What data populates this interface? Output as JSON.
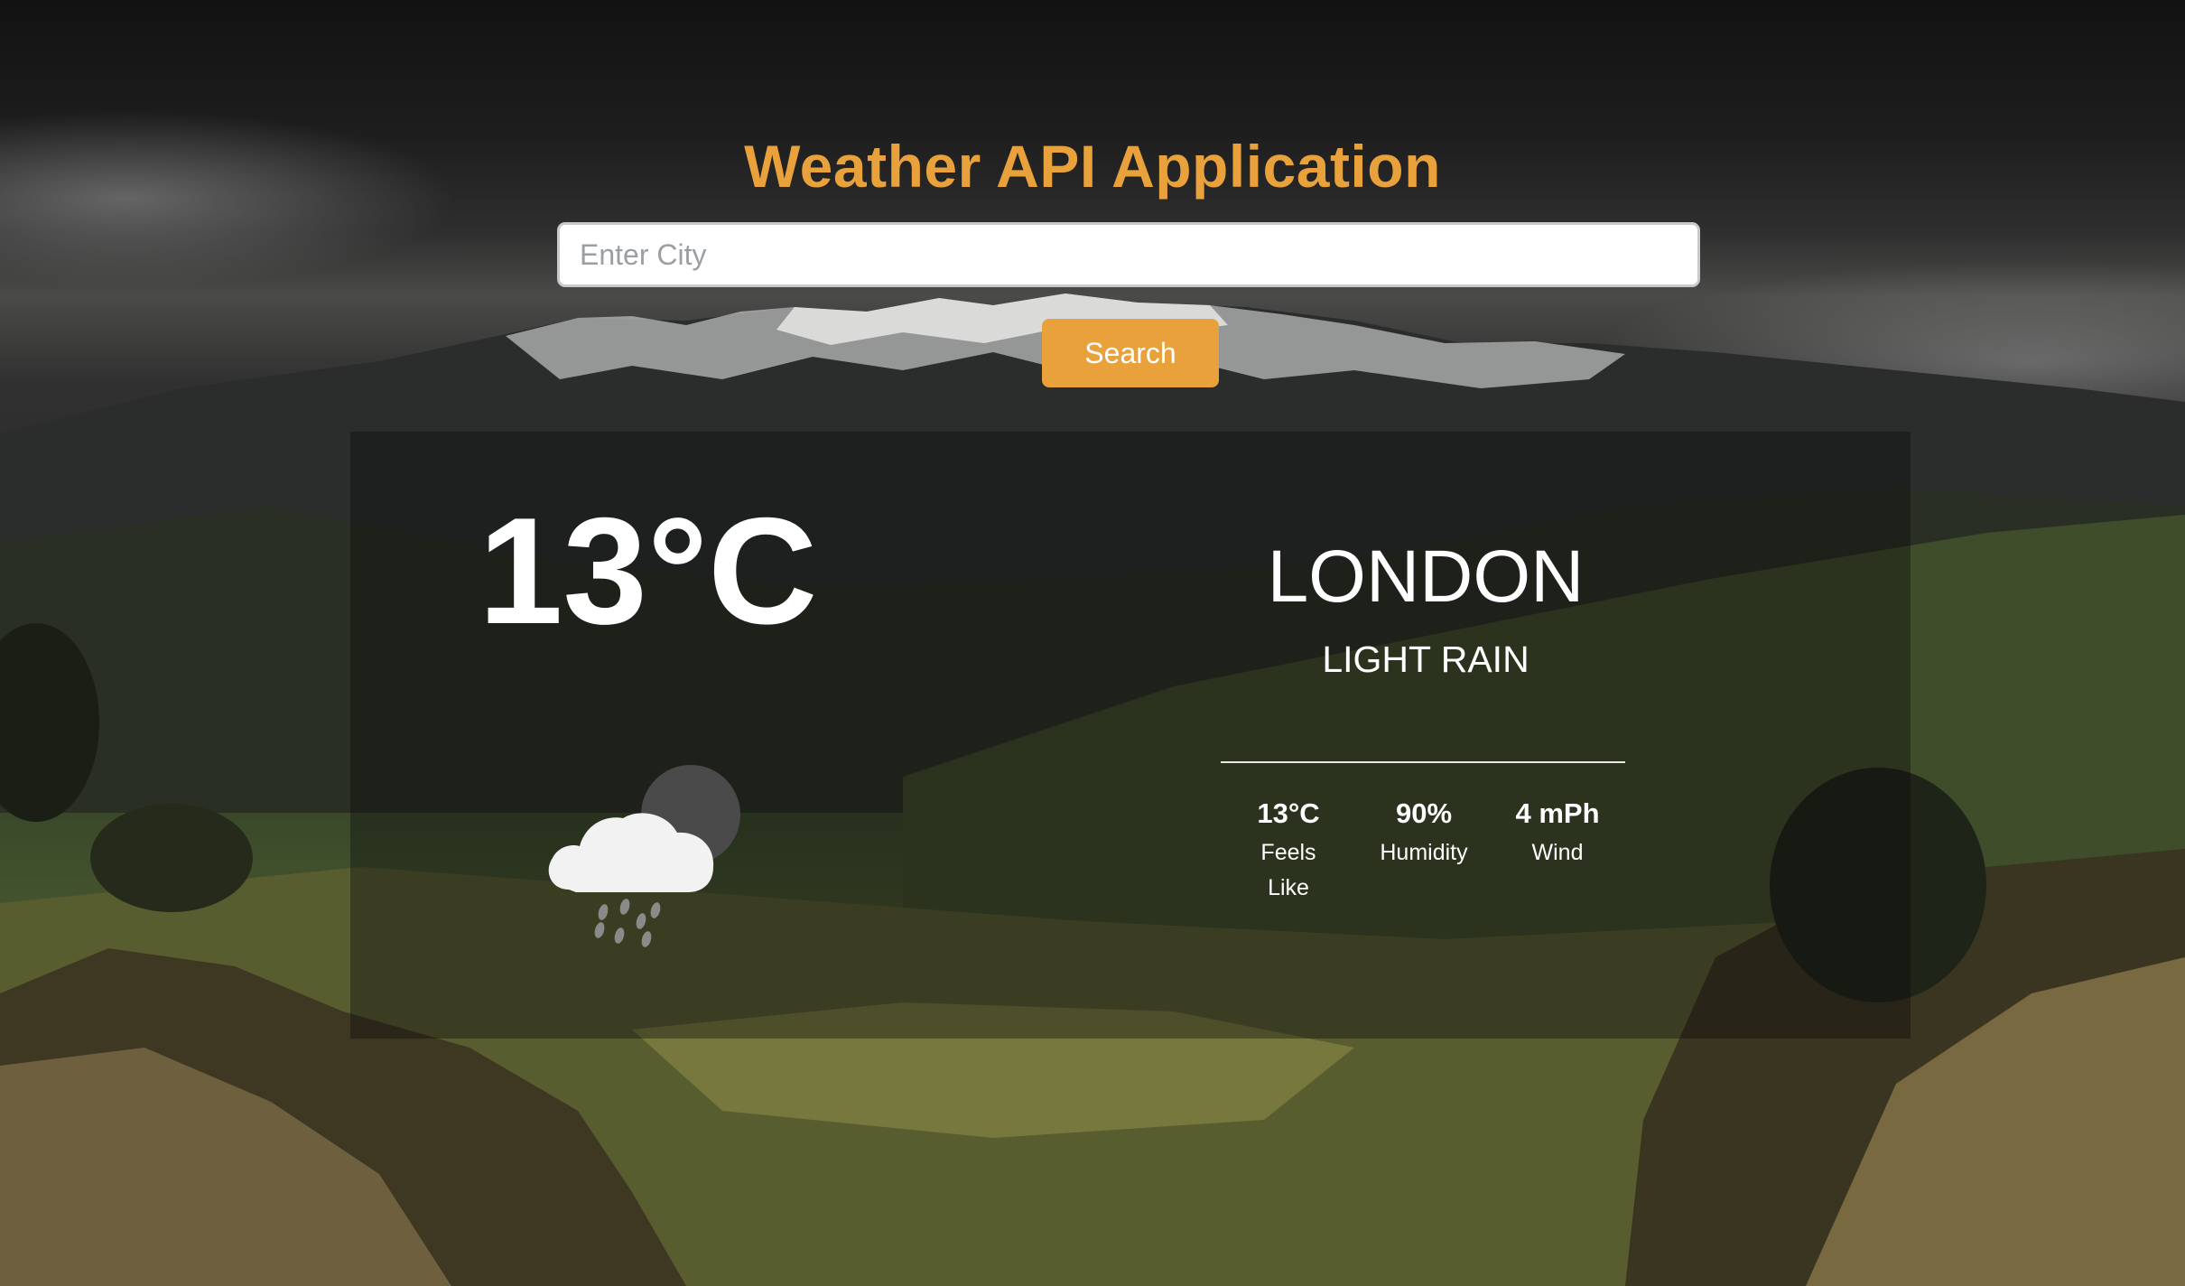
{
  "app": {
    "title": "Weather API Application"
  },
  "search": {
    "placeholder": "Enter City",
    "value": "",
    "button_label": "Search"
  },
  "weather": {
    "temperature": "13°C",
    "city": "LONDON",
    "description": "LIGHT RAIN",
    "icon": "cloud-rain-moon-icon",
    "stats": [
      {
        "value": "13°C",
        "label": "Feels Like"
      },
      {
        "value": "90%",
        "label": "Humidity"
      },
      {
        "value": "4 mPh",
        "label": "Wind"
      }
    ]
  },
  "colors": {
    "accent": "#e9a23b",
    "text": "#ffffff",
    "input_bg": "#ffffff"
  }
}
